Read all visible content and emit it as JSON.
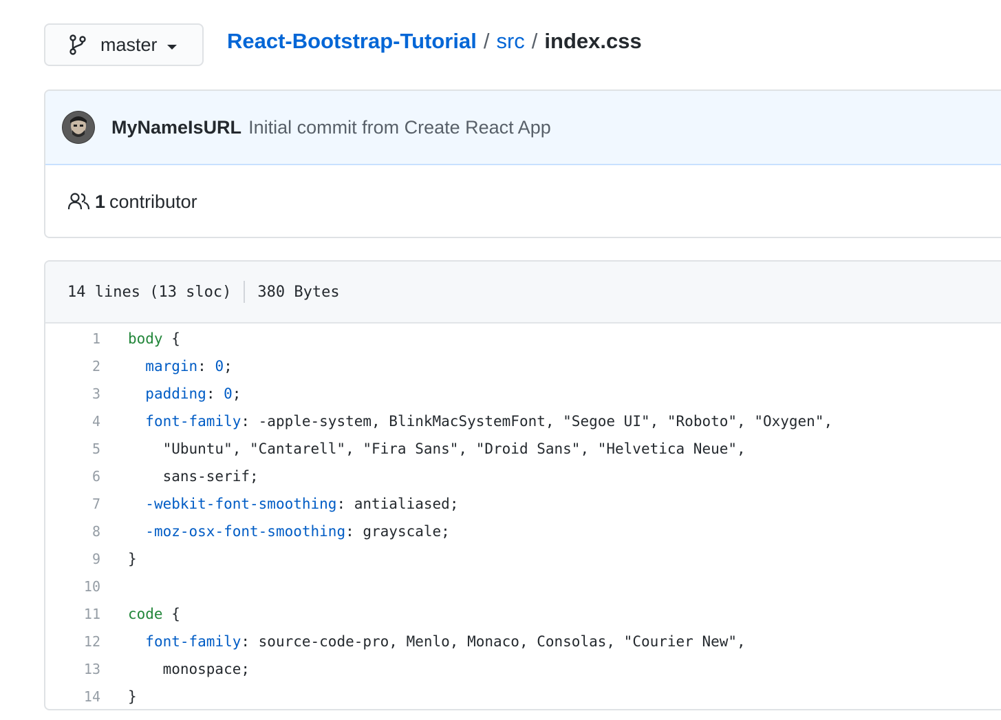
{
  "branch": {
    "label": "master"
  },
  "breadcrumb": {
    "repo": "React-Bootstrap-Tutorial",
    "separator": "/",
    "folder": "src",
    "file": "index.css"
  },
  "commit": {
    "author": "MyNameIsURL",
    "message": "Initial commit from Create React App"
  },
  "contributors": {
    "count": "1",
    "label": "contributor"
  },
  "file_info": {
    "lines": "14 lines (13 sloc)",
    "size": "380 Bytes"
  },
  "code": {
    "line_numbers": [
      "1",
      "2",
      "3",
      "4",
      "5",
      "6",
      "7",
      "8",
      "9",
      "10",
      "11",
      "12",
      "13",
      "14"
    ],
    "lines": [
      [
        {
          "t": "sel",
          "v": "body"
        },
        {
          "t": "plain",
          "v": " {"
        }
      ],
      [
        {
          "t": "plain",
          "v": "  "
        },
        {
          "t": "prop",
          "v": "margin"
        },
        {
          "t": "plain",
          "v": ": "
        },
        {
          "t": "num",
          "v": "0"
        },
        {
          "t": "plain",
          "v": ";"
        }
      ],
      [
        {
          "t": "plain",
          "v": "  "
        },
        {
          "t": "prop",
          "v": "padding"
        },
        {
          "t": "plain",
          "v": ": "
        },
        {
          "t": "num",
          "v": "0"
        },
        {
          "t": "plain",
          "v": ";"
        }
      ],
      [
        {
          "t": "plain",
          "v": "  "
        },
        {
          "t": "prop",
          "v": "font-family"
        },
        {
          "t": "plain",
          "v": ": -apple-system, BlinkMacSystemFont, \"Segoe UI\", \"Roboto\", \"Oxygen\","
        }
      ],
      [
        {
          "t": "plain",
          "v": "    \"Ubuntu\", \"Cantarell\", \"Fira Sans\", \"Droid Sans\", \"Helvetica Neue\","
        }
      ],
      [
        {
          "t": "plain",
          "v": "    sans-serif;"
        }
      ],
      [
        {
          "t": "plain",
          "v": "  "
        },
        {
          "t": "prop",
          "v": "-webkit-font-smoothing"
        },
        {
          "t": "plain",
          "v": ": antialiased;"
        }
      ],
      [
        {
          "t": "plain",
          "v": "  "
        },
        {
          "t": "prop",
          "v": "-moz-osx-font-smoothing"
        },
        {
          "t": "plain",
          "v": ": grayscale;"
        }
      ],
      [
        {
          "t": "plain",
          "v": "}"
        }
      ],
      [],
      [
        {
          "t": "sel",
          "v": "code"
        },
        {
          "t": "plain",
          "v": " {"
        }
      ],
      [
        {
          "t": "plain",
          "v": "  "
        },
        {
          "t": "prop",
          "v": "font-family"
        },
        {
          "t": "plain",
          "v": ": source-code-pro, Menlo, Monaco, Consolas, \"Courier New\","
        }
      ],
      [
        {
          "t": "plain",
          "v": "    monospace;"
        }
      ],
      [
        {
          "t": "plain",
          "v": "}"
        }
      ]
    ]
  },
  "icons": {
    "branch": "git-branch-icon",
    "people": "people-icon",
    "avatar": "user-avatar"
  },
  "colors": {
    "link": "#0366d6",
    "commit_bg": "#f1f8ff",
    "selector": "#22863a",
    "property": "#005cc5"
  }
}
